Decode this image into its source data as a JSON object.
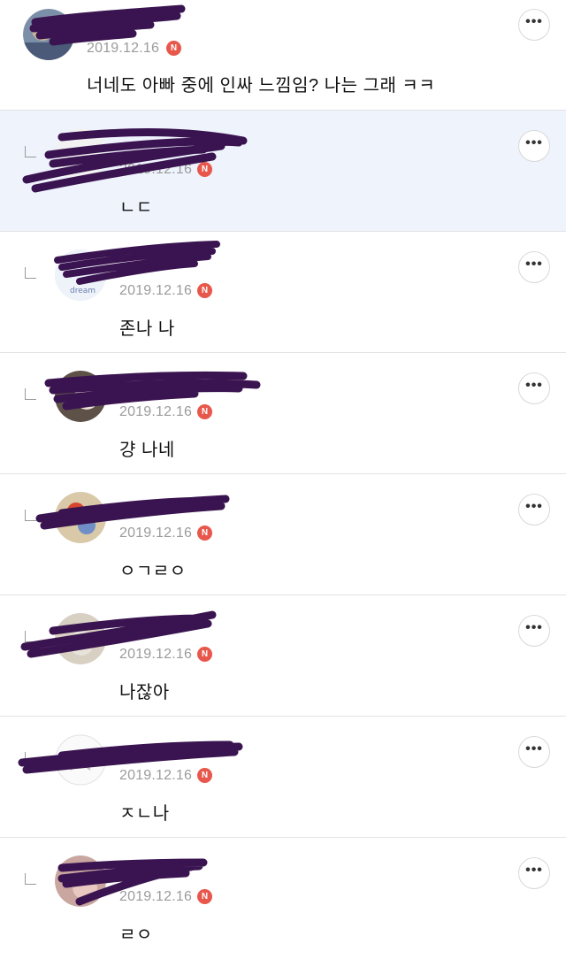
{
  "colors": {
    "highlight_bg": "#eef3fc",
    "new_badge": "#e7574b",
    "scribble": "#3a1450",
    "date_text": "#9b9b9b"
  },
  "comments": [
    {
      "date": "2019.12.16",
      "badge": "N",
      "text": "너네도 아빠 중에 인싸 느낌임? 나는 그래 ㅋㅋ",
      "more_icon": "ellipsis-icon"
    },
    {
      "date": "2019.12.16",
      "badge": "N",
      "text": "ㄴㄷ",
      "more_icon": "ellipsis-icon"
    },
    {
      "date": "2019.12.16",
      "badge": "N",
      "text": "존나 나",
      "more_icon": "ellipsis-icon"
    },
    {
      "date": "2019.12.16",
      "badge": "N",
      "text": "걍 나네",
      "more_icon": "ellipsis-icon"
    },
    {
      "date": "2019.12.16",
      "badge": "N",
      "text": "ㅇㄱㄹㅇ",
      "more_icon": "ellipsis-icon"
    },
    {
      "date": "2019.12.16",
      "badge": "N",
      "text": "나잖아",
      "more_icon": "ellipsis-icon"
    },
    {
      "date": "2019.12.16",
      "badge": "N",
      "text": "ㅈㄴ나",
      "more_icon": "ellipsis-icon"
    },
    {
      "date": "2019.12.16",
      "badge": "N",
      "text": "ㄹㅇ",
      "more_icon": "ellipsis-icon"
    }
  ],
  "more_label": "•••"
}
